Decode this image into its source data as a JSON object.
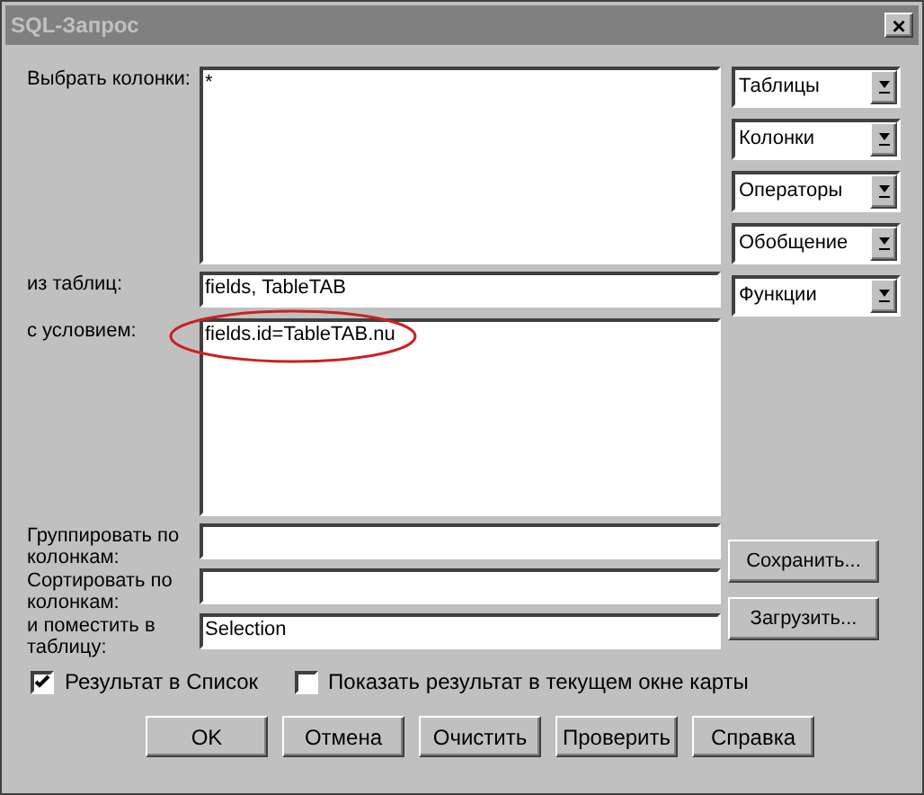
{
  "window": {
    "title": "SQL-Запрос",
    "close": "×"
  },
  "fields": [
    {
      "label": "Выбрать колонки:",
      "value": "*",
      "kind": "area"
    },
    {
      "label": "из таблиц:",
      "value": "fields, TableTAB",
      "kind": "line"
    },
    {
      "label": "с условием:",
      "value": "fields.id=TableTAB.nu",
      "kind": "area",
      "annotated": true
    },
    {
      "label": "Группировать по колонкам:",
      "kind": "line"
    },
    {
      "label": "Сортировать по колонкам:",
      "kind": "line"
    },
    {
      "label": "и поместить в таблицу:",
      "value": "Selection",
      "kind": "line"
    }
  ],
  "dropdowns": [
    "Таблицы",
    "Колонки",
    "Операторы",
    "Обобщение",
    "Функции"
  ],
  "side_buttons": [
    "Сохранить...",
    "Загрузить..."
  ],
  "checkboxes": [
    {
      "label": "Результат в Список",
      "checked": true
    },
    {
      "label": "Показать результат в текущем окне карты",
      "checked": false
    }
  ],
  "buttons": [
    "OK",
    "Отмена",
    "Очистить",
    "Проверить",
    "Справка"
  ]
}
